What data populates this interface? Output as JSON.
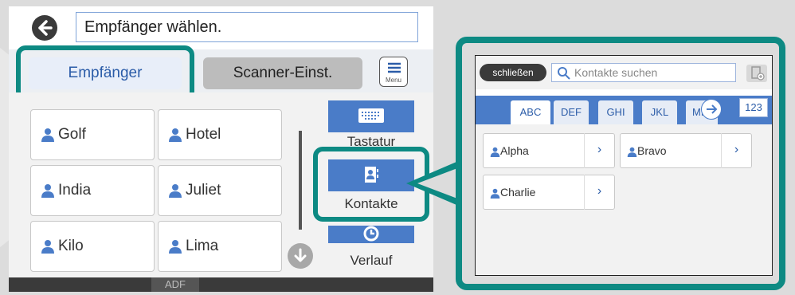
{
  "header": {
    "title": "Empfänger wählen."
  },
  "tabs": [
    {
      "label": "Empfänger"
    },
    {
      "label": "Scanner-Einst."
    }
  ],
  "menu": {
    "label": "Menu"
  },
  "contacts": [
    {
      "label": "Golf"
    },
    {
      "label": "Hotel"
    },
    {
      "label": "India"
    },
    {
      "label": "Juliet"
    },
    {
      "label": "Kilo"
    },
    {
      "label": "Lima"
    }
  ],
  "side_buttons": {
    "keyboard": "Tastatur",
    "contacts": "Kontakte",
    "history": "Verlauf"
  },
  "footer": {
    "adf": "ADF"
  },
  "zoom_panel": {
    "close": "schließen",
    "search_placeholder": "Kontakte suchen",
    "letter_tabs": [
      "ABC",
      "DEF",
      "GHI",
      "JKL",
      "MI"
    ],
    "number_tab": "123",
    "contacts": [
      {
        "label": "Alpha"
      },
      {
        "label": "Bravo"
      },
      {
        "label": "Charlie"
      }
    ]
  },
  "colors": {
    "accent": "#0d8a83",
    "blue": "#4a7cc8",
    "dark": "#3a3a3a"
  }
}
